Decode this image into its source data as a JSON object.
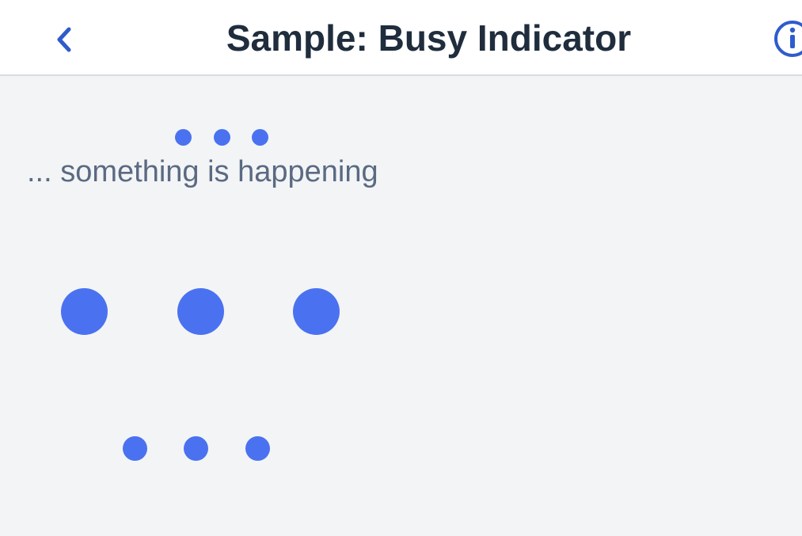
{
  "header": {
    "title": "Sample: Busy Indicator",
    "back_icon": "chevron-left-icon",
    "info_icon": "info-icon"
  },
  "busy_with_text": {
    "text": "... something is happening"
  },
  "colors": {
    "accent": "#4a72f0",
    "header_bg": "#ffffff",
    "page_bg": "#f3f4f6",
    "title_text": "#1f2d3d",
    "body_text": "#5a6a82",
    "icon_blue": "#2f5ccc"
  }
}
